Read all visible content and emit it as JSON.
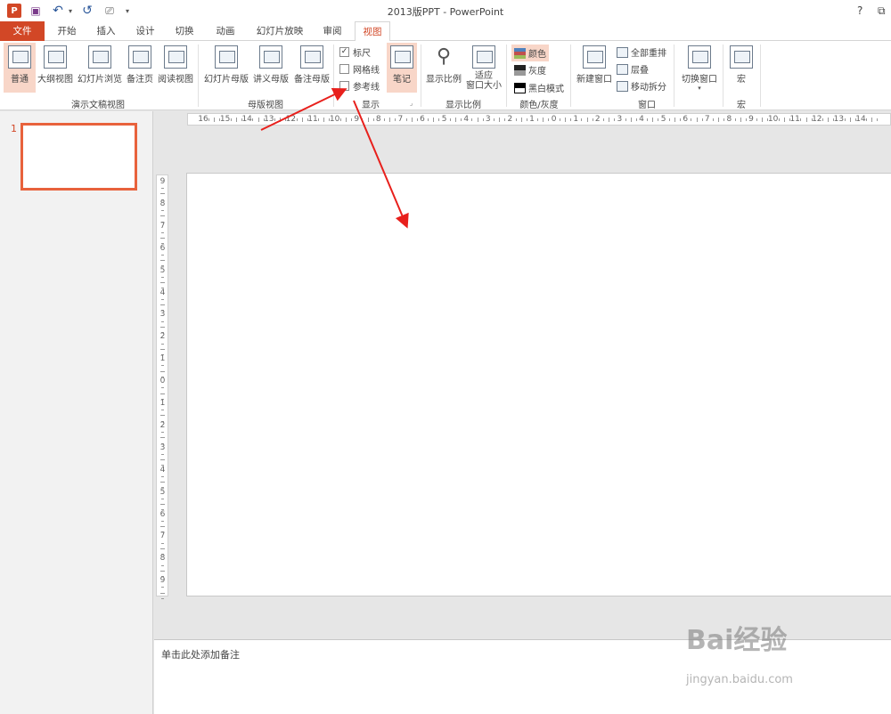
{
  "window": {
    "title": "2013版PPT - PowerPoint",
    "help": "?",
    "restore": "⧉",
    "minimize": "—"
  },
  "quick_access": {
    "logo": "P",
    "save": "💾",
    "undo": "↶",
    "redo": "↺",
    "present": "⎚",
    "more": "▾"
  },
  "tabs": [
    "文件",
    "开始",
    "插入",
    "设计",
    "切换",
    "动画",
    "幻灯片放映",
    "审阅",
    "视图"
  ],
  "ribbon": {
    "presentation_views": {
      "label": "演示文稿视图",
      "buttons": [
        "普通",
        "大纲视图",
        "幻灯片浏览",
        "备注页",
        "阅读视图"
      ]
    },
    "master_views": {
      "label": "母版视图",
      "buttons": [
        "幻灯片母版",
        "讲义母版",
        "备注母版"
      ]
    },
    "show": {
      "label": "显示",
      "checkboxes": [
        {
          "label": "标尺",
          "checked": true
        },
        {
          "label": "网格线",
          "checked": false
        },
        {
          "label": "参考线",
          "checked": false
        }
      ],
      "notes_button": "笔记"
    },
    "zoom": {
      "label": "显示比例",
      "zoom_button": "显示比例",
      "fit_button_1": "适应",
      "fit_button_2": "窗口大小"
    },
    "color": {
      "label": "颜色/灰度",
      "items": [
        "颜色",
        "灰度",
        "黑白模式"
      ]
    },
    "window": {
      "label": "窗口",
      "new_window": "新建窗口",
      "arrange_all": "全部重排",
      "cascade": "层叠",
      "move_split": "移动拆分"
    },
    "switch_windows": "切换窗口",
    "macros": {
      "label": "宏",
      "button": "宏"
    }
  },
  "slides_pane": {
    "slide_number": "1"
  },
  "hruler_labels": [
    "16",
    "15",
    "14",
    "13",
    "12",
    "11",
    "10",
    "9",
    "8",
    "7",
    "6",
    "5",
    "4",
    "3",
    "2",
    "1",
    "0",
    "1",
    "2",
    "3",
    "4",
    "5",
    "6",
    "7",
    "8",
    "9",
    "10",
    "11",
    "12",
    "13",
    "14"
  ],
  "vruler_labels": [
    "9",
    "8",
    "7",
    "6",
    "5",
    "4",
    "3",
    "2",
    "1",
    "0",
    "1",
    "2",
    "3",
    "4",
    "5",
    "6",
    "7",
    "8",
    "9"
  ],
  "notes_placeholder": "单击此处添加备注",
  "watermark": {
    "brand": "Bai经验",
    "url": "jingyan.baidu.com"
  },
  "colors": {
    "accent": "#d24726",
    "arrow": "#e8201c"
  }
}
